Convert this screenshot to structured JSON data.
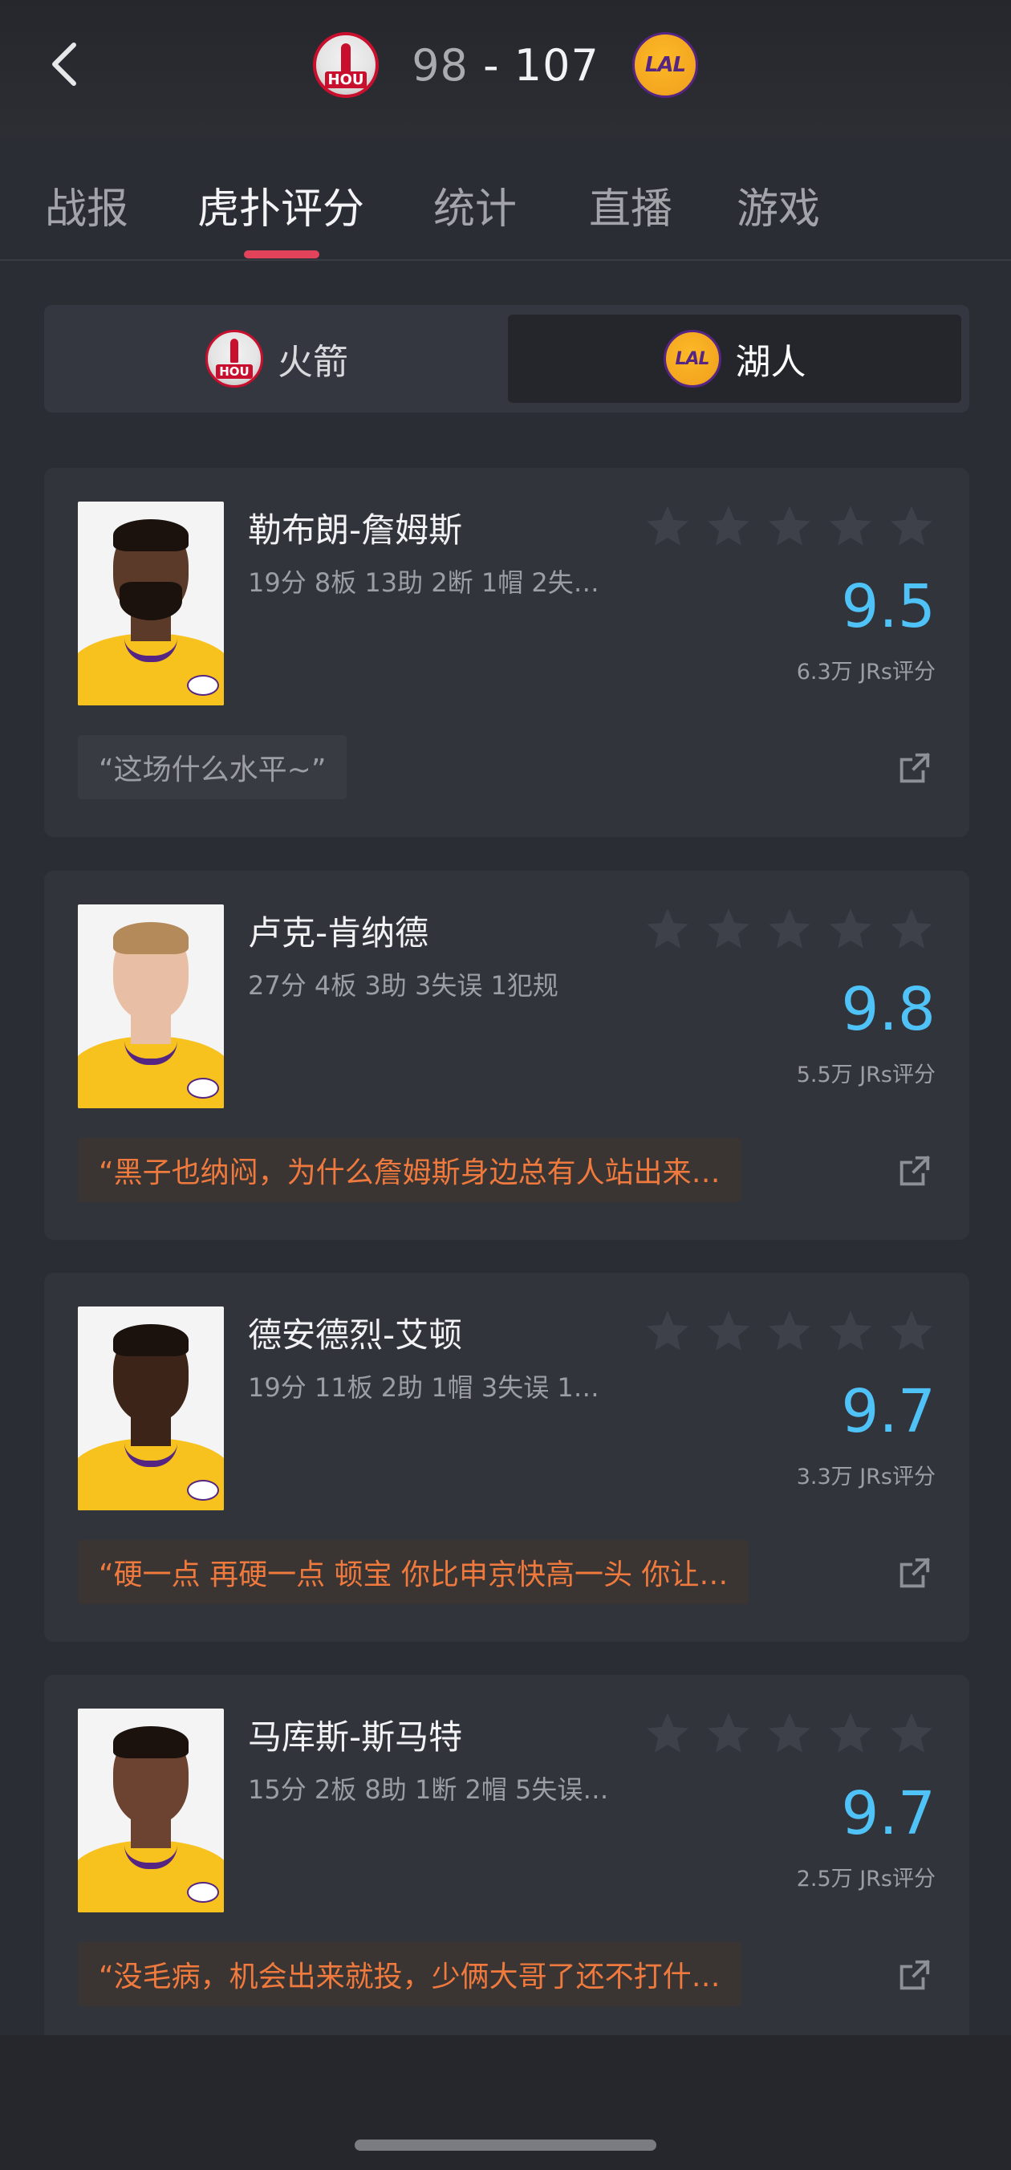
{
  "header": {
    "home_team_logo_text": "HOU",
    "away_team_logo_text": "LAL",
    "home_score": "98",
    "separator": " - ",
    "away_score": "107"
  },
  "tabs": [
    {
      "label": "战报",
      "active": false
    },
    {
      "label": "虎扑评分",
      "active": true
    },
    {
      "label": "统计",
      "active": false
    },
    {
      "label": "直播",
      "active": false
    },
    {
      "label": "游戏",
      "active": false
    }
  ],
  "segment": {
    "left_team": "火箭",
    "right_team": "湖人",
    "selected": "湖人"
  },
  "players": [
    {
      "name": "勒布朗-詹姆斯",
      "stats": "19分 8板 13助 2断 1帽 2失…",
      "rating": "9.5",
      "count": "6.3万 JRs评分",
      "comment": "“这场什么水平~”",
      "stars": 0
    },
    {
      "name": "卢克-肯纳德",
      "stats": "27分 4板 3助 3失误 1犯规",
      "rating": "9.8",
      "count": "5.5万 JRs评分",
      "comment": "“黑子也纳闷，为什么詹姆斯身边总有人站出来…",
      "stars": 0
    },
    {
      "name": "德安德烈-艾顿",
      "stats": "19分 11板 2助 1帽 3失误 1…",
      "rating": "9.7",
      "count": "3.3万 JRs评分",
      "comment": "“硬一点 再硬一点 顿宝 你比申京快高一头 你让…",
      "stars": 0
    },
    {
      "name": "马库斯-斯马特",
      "stats": "15分 2板 8助 1断 2帽 5失误…",
      "rating": "9.7",
      "count": "2.5万 JRs评分",
      "comment": "“没毛病，机会出来就投，少俩大哥了还不打什…",
      "stars": 0
    }
  ],
  "colors": {
    "background": "#2b2d35",
    "card": "#32343c",
    "rating": "#4fc3f7",
    "comment_highlight": "#f07a3e",
    "tab_indicator": "#e2435a"
  },
  "icons": {
    "back": "chevron-left-icon",
    "star": "star-icon",
    "share": "share-icon"
  }
}
